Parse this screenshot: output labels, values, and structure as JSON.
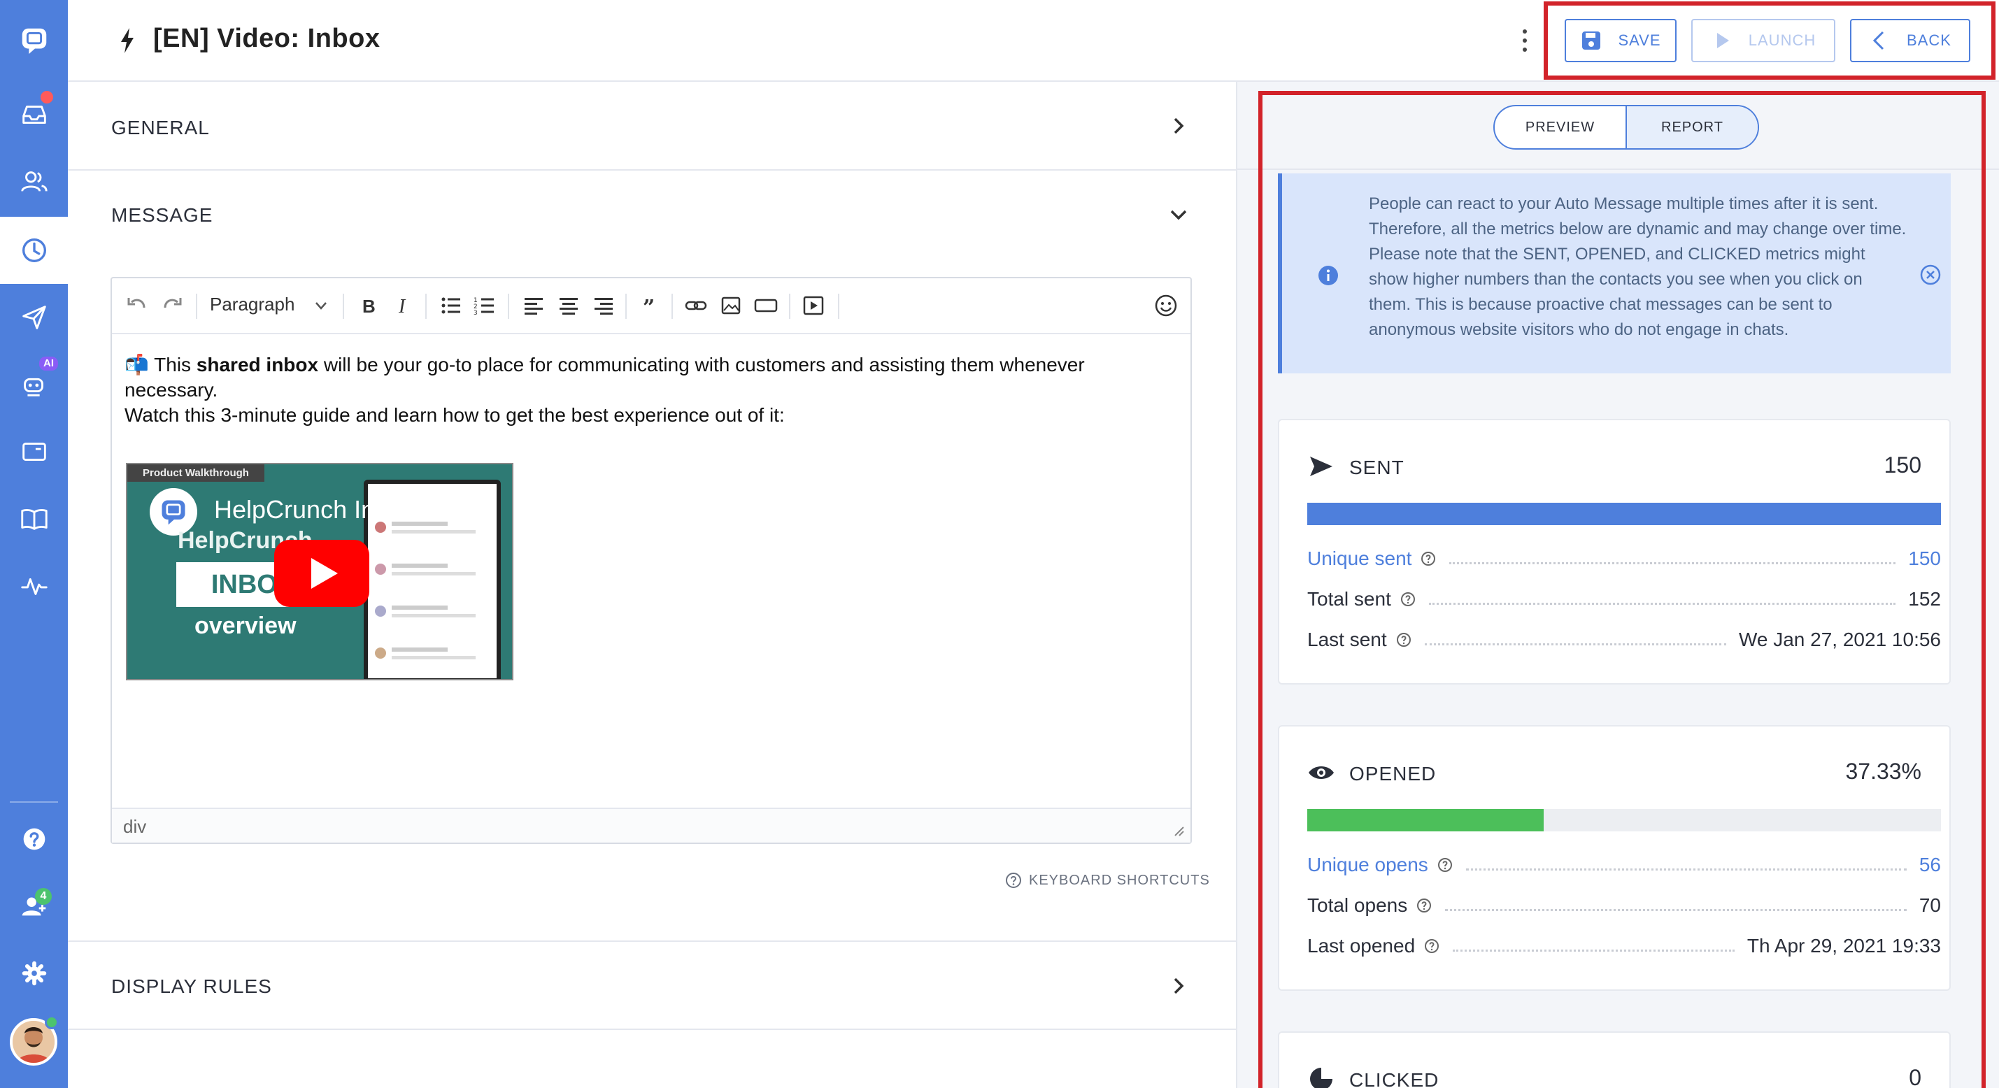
{
  "header": {
    "title": "[EN] Video: Inbox",
    "actions": {
      "save": "SAVE",
      "launch": "LAUNCH",
      "back": "BACK"
    }
  },
  "sidebar": {
    "items": [
      {
        "icon": "chat-logo-icon"
      },
      {
        "icon": "inbox-icon",
        "badge": "dot"
      },
      {
        "icon": "contacts-icon"
      },
      {
        "icon": "auto-messages-clock-icon",
        "active": true
      },
      {
        "icon": "send-icon"
      },
      {
        "icon": "ai-bot-icon",
        "badge": "AI"
      },
      {
        "icon": "widget-icon"
      },
      {
        "icon": "knowledge-book-icon"
      },
      {
        "icon": "activity-pulse-icon"
      },
      {
        "icon": "help-icon"
      },
      {
        "icon": "team-icon",
        "badge": "4"
      },
      {
        "icon": "settings-icon"
      },
      {
        "icon": "avatar"
      }
    ],
    "ai_badge": "AI",
    "team_badge": "4"
  },
  "sections": {
    "general": "GENERAL",
    "message": "MESSAGE",
    "display_rules": "DISPLAY RULES"
  },
  "editor": {
    "paragraph_select": "Paragraph",
    "text_prefix": "📬 This ",
    "text_bold": "shared inbox",
    "text_rest": " will be your go-to place for communicating with customers and assisting them whenever necessary.",
    "text_line2": "Watch this 3-minute guide and learn how to get the best experience out of it:",
    "video": {
      "tag": "Product Walkthrough",
      "title": "HelpCrunch Inbo...",
      "brand": "HelpCrunch",
      "inbox": "INBOX",
      "overview": "overview"
    },
    "status_path": "div",
    "keyboard_shortcuts": "KEYBOARD SHORTCUTS"
  },
  "report": {
    "tabs": {
      "preview": "PREVIEW",
      "report": "REPORT",
      "active": "REPORT"
    },
    "notice": "People can react to your Auto Message multiple times after it is sent. Therefore, all the metrics below are dynamic and may change over time. Please note that the SENT, OPENED, and CLICKED metrics might show higher numbers than the contacts you see when you click on them. This is because proactive chat messages can be sent to anonymous website visitors who do not engage in chats.",
    "sent": {
      "title": "SENT",
      "total": "150",
      "bar_fraction": 1.0,
      "color": "#4e7fdc",
      "metrics": [
        {
          "label": "Unique sent",
          "value": "150",
          "link": true
        },
        {
          "label": "Total sent",
          "value": "152",
          "link": false
        },
        {
          "label": "Last sent",
          "value": "We Jan 27, 2021 10:56",
          "link": false
        }
      ]
    },
    "opened": {
      "title": "OPENED",
      "total": "37.33%",
      "bar_fraction": 0.3733,
      "color": "#4cbf5a",
      "metrics": [
        {
          "label": "Unique opens",
          "value": "56",
          "link": true
        },
        {
          "label": "Total opens",
          "value": "70",
          "link": false
        },
        {
          "label": "Last opened",
          "value": "Th Apr 29, 2021 19:33",
          "link": false
        }
      ]
    },
    "clicked": {
      "title": "CLICKED",
      "total": "0"
    }
  },
  "colors": {
    "accent": "#4e7fdc",
    "highlight": "#d2232a",
    "opened_bar": "#4cbf5a"
  }
}
